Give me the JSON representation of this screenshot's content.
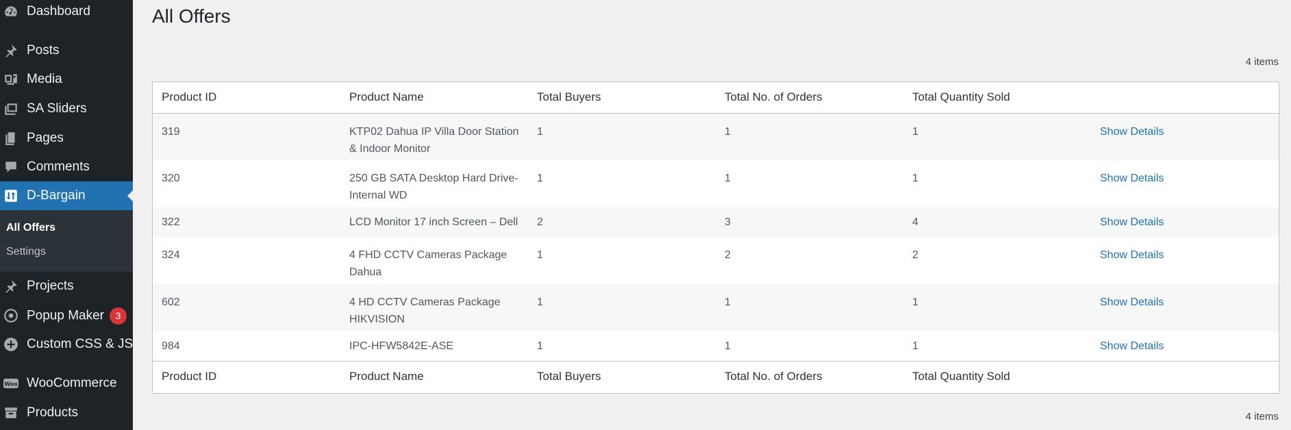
{
  "sidebar": {
    "items": [
      {
        "label": "Dashboard",
        "icon": "dashboard-icon"
      },
      {
        "label": "Posts",
        "icon": "pin-icon"
      },
      {
        "label": "Media",
        "icon": "media-icon"
      },
      {
        "label": "SA Sliders",
        "icon": "slides-icon"
      },
      {
        "label": "Pages",
        "icon": "pages-icon"
      },
      {
        "label": "Comments",
        "icon": "comment-icon"
      },
      {
        "label": "D-Bargain",
        "icon": "d-bargain-icon"
      },
      {
        "label": "Projects",
        "icon": "pin-icon"
      },
      {
        "label": "Popup Maker",
        "icon": "popup-maker-icon",
        "badge": "3"
      },
      {
        "label": "Custom CSS & JS",
        "icon": "plus-circle-icon"
      },
      {
        "label": "WooCommerce",
        "icon": "woo-icon",
        "icon_text": "Woo"
      },
      {
        "label": "Products",
        "icon": "archive-icon"
      }
    ],
    "submenu": [
      {
        "label": "All Offers"
      },
      {
        "label": "Settings"
      }
    ]
  },
  "page": {
    "title": "All Offers",
    "items_count": "4 items"
  },
  "table": {
    "columns": [
      "Product ID",
      "Product Name",
      "Total Buyers",
      "Total No. of Orders",
      "Total Quantity Sold",
      ""
    ],
    "rows": [
      {
        "id": "319",
        "name": "KTP02 Dahua IP Villa Door Station & Indoor Monitor",
        "buyers": "1",
        "orders": "1",
        "qty": "1",
        "action": "Show Details"
      },
      {
        "id": "320",
        "name": "250 GB SATA Desktop Hard Drive-Internal WD",
        "buyers": "1",
        "orders": "1",
        "qty": "1",
        "action": "Show Details"
      },
      {
        "id": "322",
        "name": "LCD Monitor 17 inch Screen – Dell",
        "buyers": "2",
        "orders": "3",
        "qty": "4",
        "action": "Show Details"
      },
      {
        "id": "324",
        "name": "4 FHD CCTV Cameras Package Dahua",
        "buyers": "1",
        "orders": "2",
        "qty": "2",
        "action": "Show Details"
      },
      {
        "id": "602",
        "name": "4 HD CCTV Cameras Package HIKVISION",
        "buyers": "1",
        "orders": "1",
        "qty": "1",
        "action": "Show Details"
      },
      {
        "id": "984",
        "name": "IPC-HFW5842E-ASE",
        "buyers": "1",
        "orders": "1",
        "qty": "1",
        "action": "Show Details"
      }
    ]
  },
  "colors": {
    "sidebar_bg": "#1d2327",
    "active_bg": "#2271b1",
    "link": "#2271b1",
    "badge": "#d63638"
  }
}
